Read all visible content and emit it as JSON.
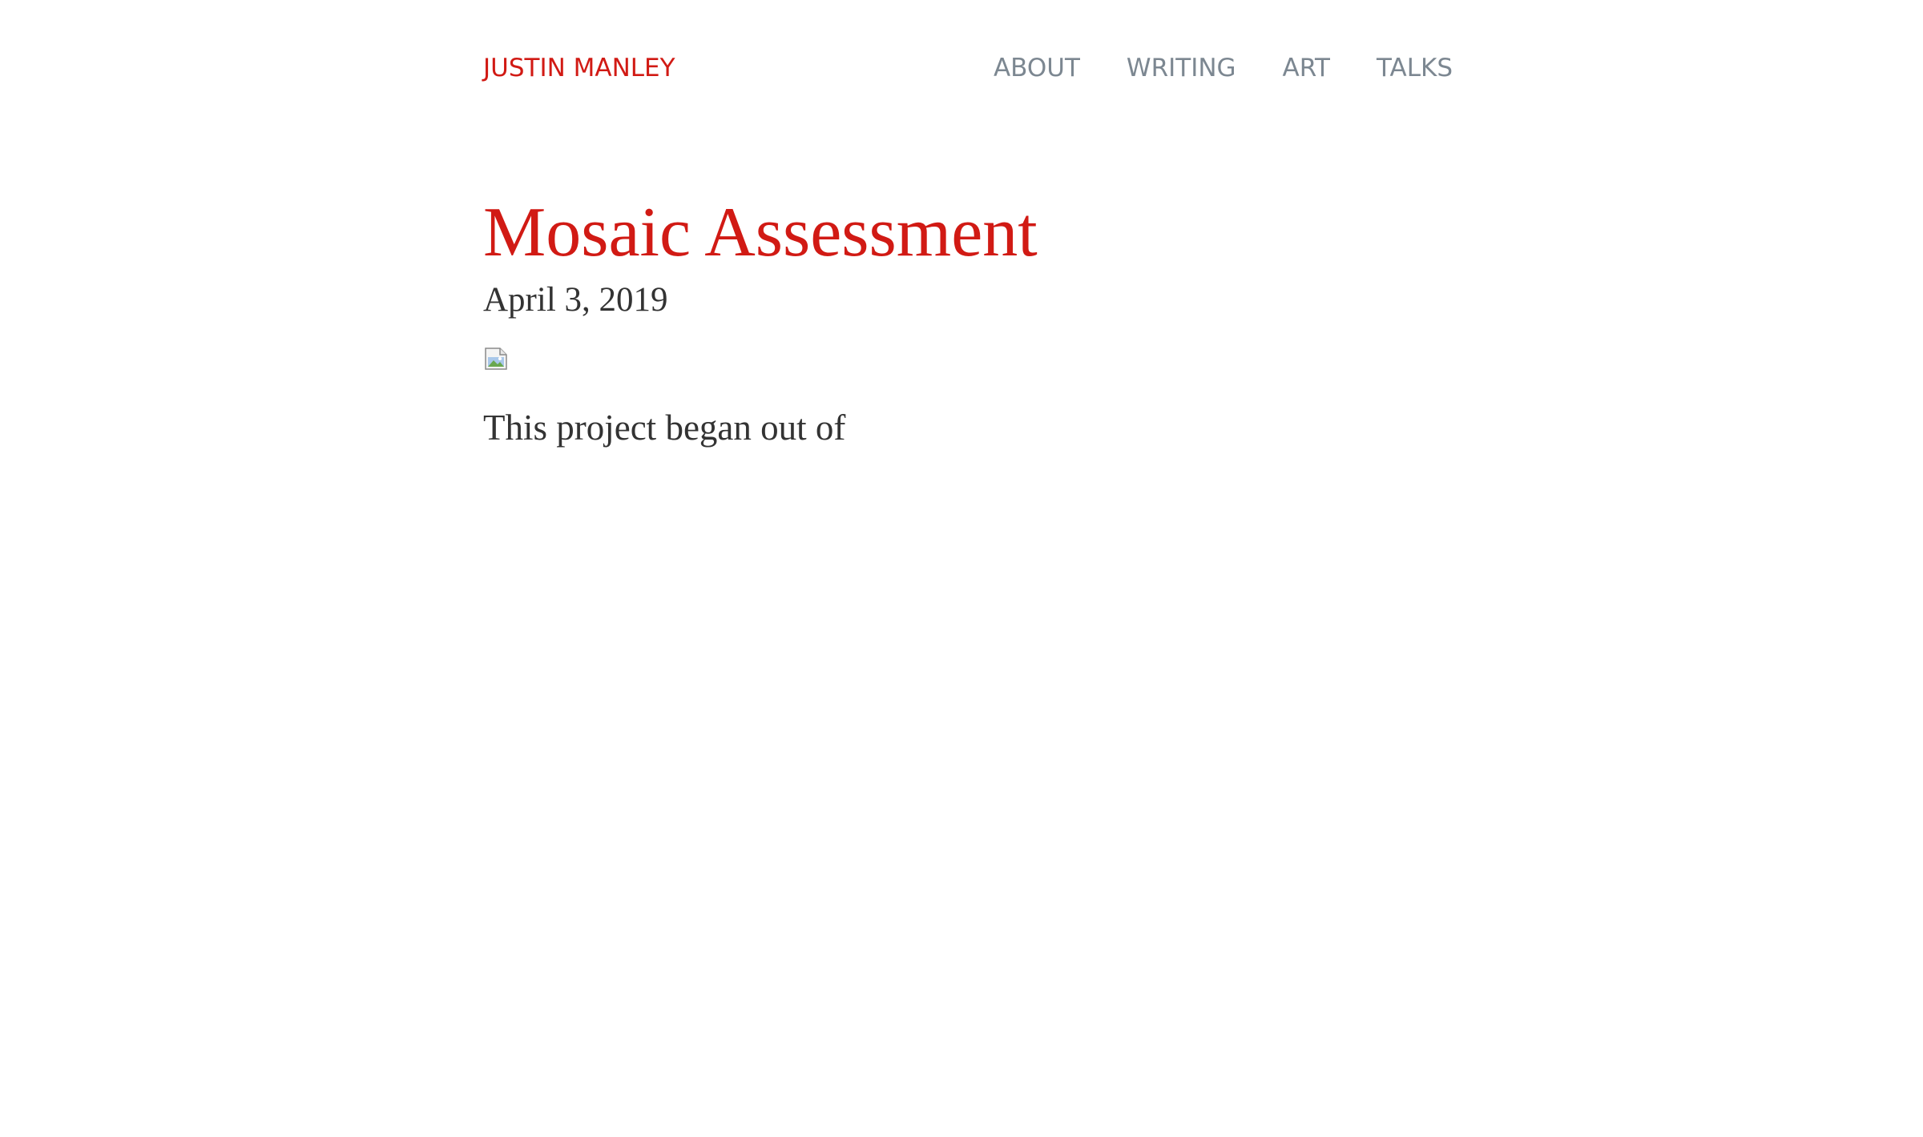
{
  "header": {
    "site_title": "JUSTIN MANLEY",
    "nav": [
      {
        "label": "ABOUT"
      },
      {
        "label": "WRITING"
      },
      {
        "label": "ART"
      },
      {
        "label": "TALKS"
      }
    ]
  },
  "post": {
    "title": "Mosaic Assessment",
    "date": "April 3, 2019",
    "image_icon": "broken-image-icon",
    "body_text": "This project began out of"
  },
  "colors": {
    "accent": "#d11a14",
    "nav_text": "#7c8791",
    "body_text": "#333333",
    "background": "#ffffff"
  }
}
